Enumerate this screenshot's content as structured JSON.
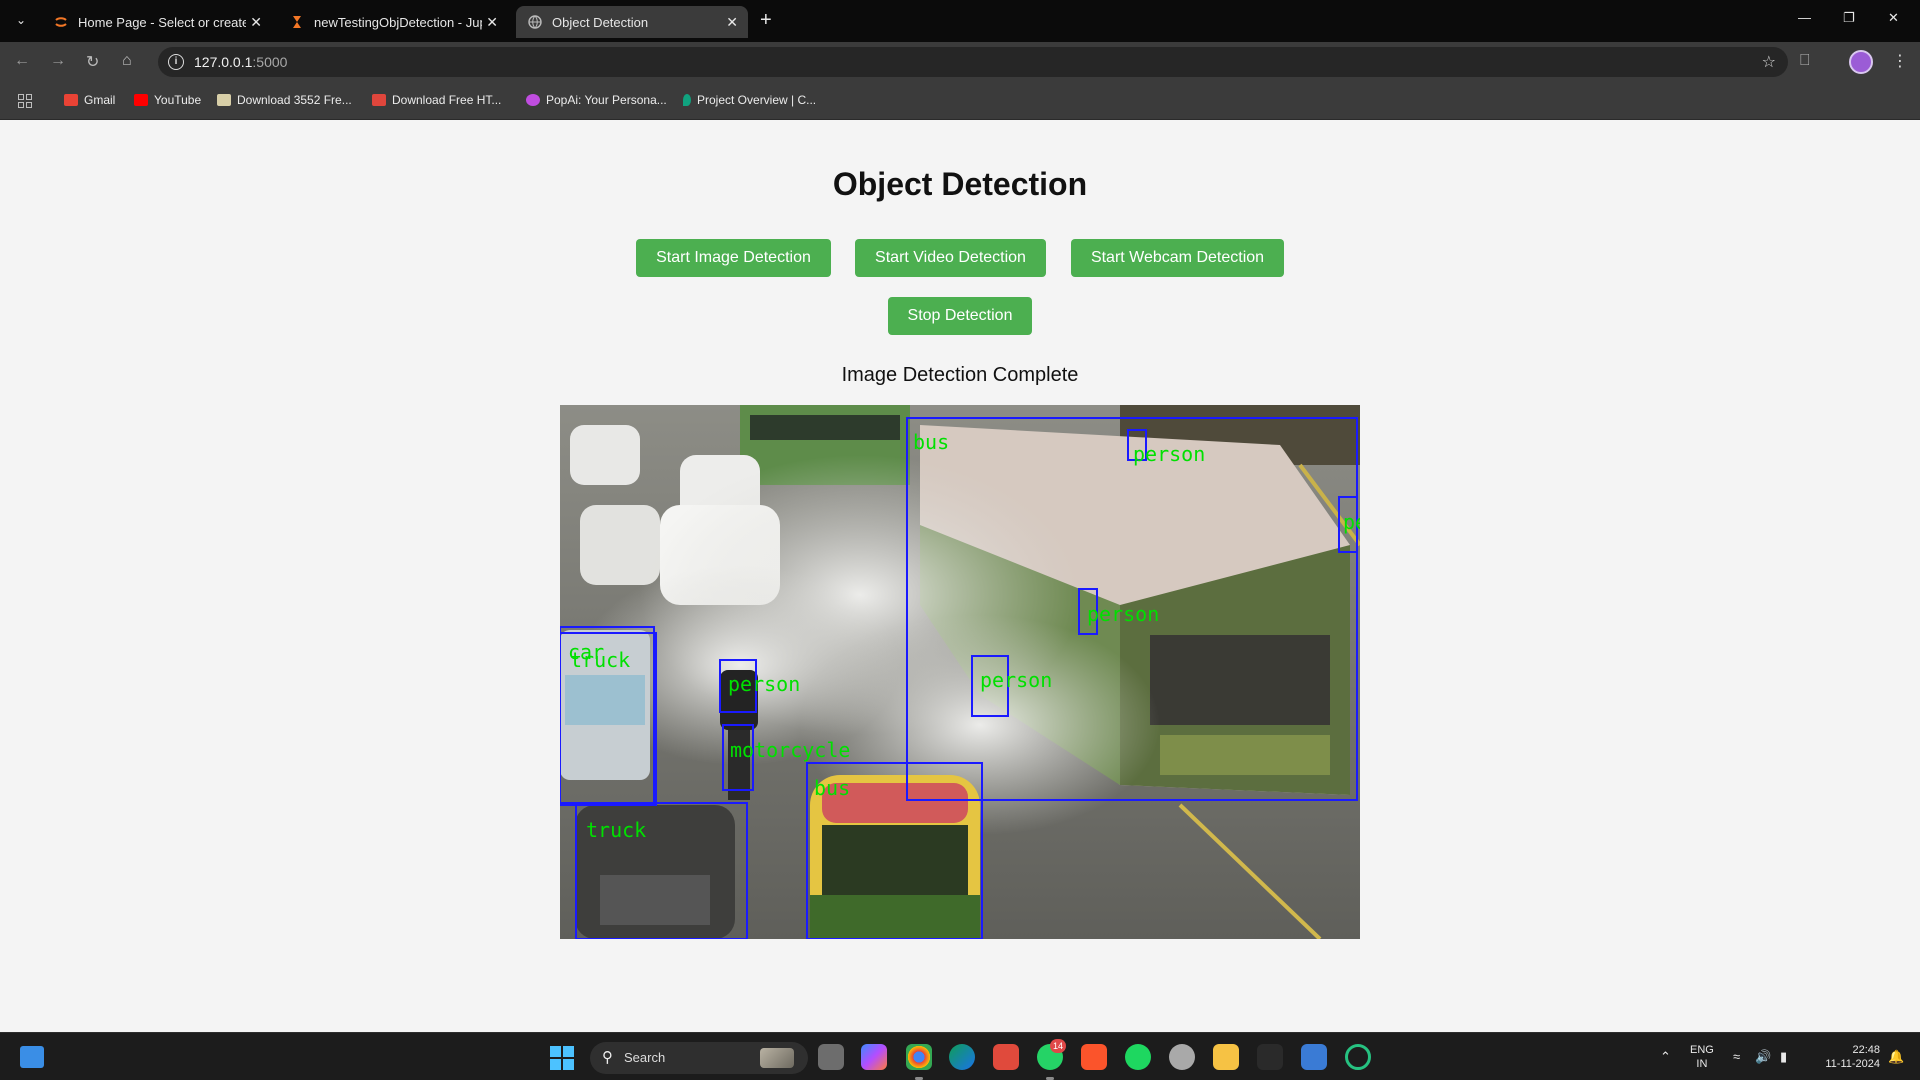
{
  "browser": {
    "tabs": [
      {
        "title": "Home Page - Select or create a",
        "active": false
      },
      {
        "title": "newTestingObjDetection - Jupyter",
        "active": false
      },
      {
        "title": "Object Detection",
        "active": true
      }
    ],
    "address": {
      "host": "127.0.0.1",
      "port": ":5000"
    },
    "bookmarks": [
      {
        "label": "Gmail",
        "color": "#ea4335"
      },
      {
        "label": "YouTube",
        "color": "#ff0000"
      },
      {
        "label": "Download 3552 Fre...",
        "color": "#d8cfa8"
      },
      {
        "label": "Download Free HT...",
        "color": "#e0463c"
      },
      {
        "label": "PopAi: Your Persona...",
        "color": "#c04de0"
      },
      {
        "label": "Project Overview | C...",
        "color": "#10a37f"
      }
    ]
  },
  "page": {
    "title": "Object Detection",
    "buttons": {
      "image": "Start Image Detection",
      "video": "Start Video Detection",
      "webcam": "Start Webcam Detection",
      "stop": "Stop Detection"
    },
    "status": "Image Detection Complete",
    "button_color": "#4caf50"
  },
  "detections": [
    {
      "label": "bus"
    },
    {
      "label": "person"
    },
    {
      "label": "person"
    },
    {
      "label": "person"
    },
    {
      "label": "person"
    },
    {
      "label": "car"
    },
    {
      "label": "truck"
    },
    {
      "label": "person"
    },
    {
      "label": "motorcycle"
    },
    {
      "label": "bus"
    },
    {
      "label": "truck"
    }
  ],
  "detection_colors": {
    "box": "#1a1aff",
    "label": "#00e000"
  },
  "taskbar": {
    "search_label": "Search",
    "notification_count": "14",
    "language": "ENG",
    "region": "IN",
    "time": "22:48",
    "date": "11-11-2024"
  }
}
